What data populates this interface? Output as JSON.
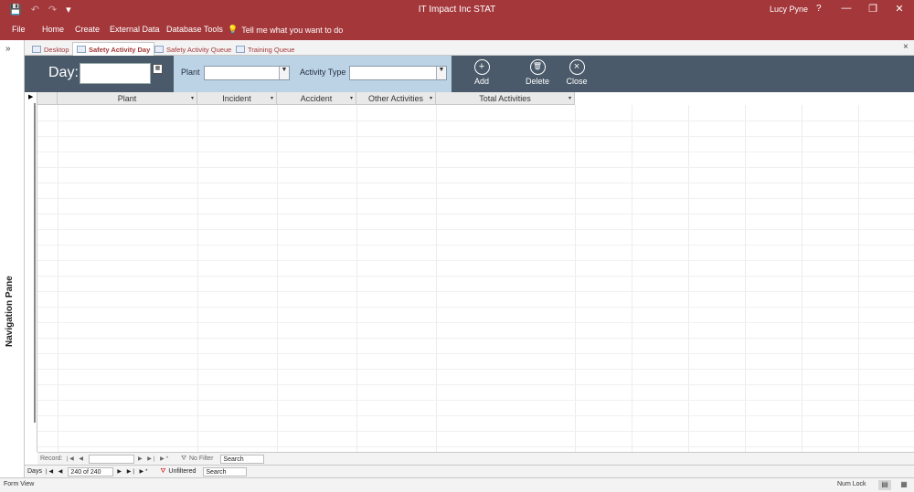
{
  "titlebar": {
    "title": "IT Impact Inc STAT",
    "user": "Lucy Pyne",
    "help": "?",
    "qat": {
      "save_icon": "save-icon",
      "undo_icon": "undo-icon",
      "redo_icon": "redo-icon",
      "customize_icon": "customize-qat-icon"
    },
    "window_buttons": {
      "minimize": "—",
      "restore": "❐",
      "close": "✕"
    }
  },
  "ribbon": {
    "tabs": [
      "File",
      "Home",
      "Create",
      "External Data",
      "Database Tools"
    ],
    "tell_me": "Tell me what you want to do"
  },
  "nav_pane": {
    "label": "Navigation Pane",
    "toggle": "»"
  },
  "doc_tabs": {
    "tabs": [
      {
        "label": "Desktop",
        "active": false
      },
      {
        "label": "Safety Activity Day",
        "active": true
      },
      {
        "label": "Safety Activity Queue",
        "active": false
      },
      {
        "label": "Training Queue",
        "active": false
      }
    ],
    "close": "×"
  },
  "form_header": {
    "day_label": "Day:",
    "day_value": "",
    "plant_label": "Plant",
    "plant_value": "",
    "activity_type_label": "Activity Type",
    "activity_type_value": "",
    "buttons": [
      {
        "label": "Add",
        "glyph": "+"
      },
      {
        "label": "Delete",
        "glyph": "🗑"
      },
      {
        "label": "Close",
        "glyph": "×"
      }
    ]
  },
  "datasheet": {
    "columns": [
      "Plant",
      "Incident",
      "Accident",
      "Other Activities",
      "Total Activities"
    ],
    "rows": []
  },
  "inner_nav": {
    "record_label": "Record:",
    "record_value": "",
    "filter_label": "No Filter",
    "search_label": "Search"
  },
  "outer_nav": {
    "record_label": "Days",
    "record_value": "240 of 240",
    "filter_label": "Unfiltered",
    "search_label": "Search"
  },
  "statusbar": {
    "view": "Form View",
    "num_lock": "Num Lock"
  },
  "colors": {
    "accent": "#a4373a",
    "form_header": "#4a5a6a",
    "filter_panel": "#bcd3e6"
  }
}
